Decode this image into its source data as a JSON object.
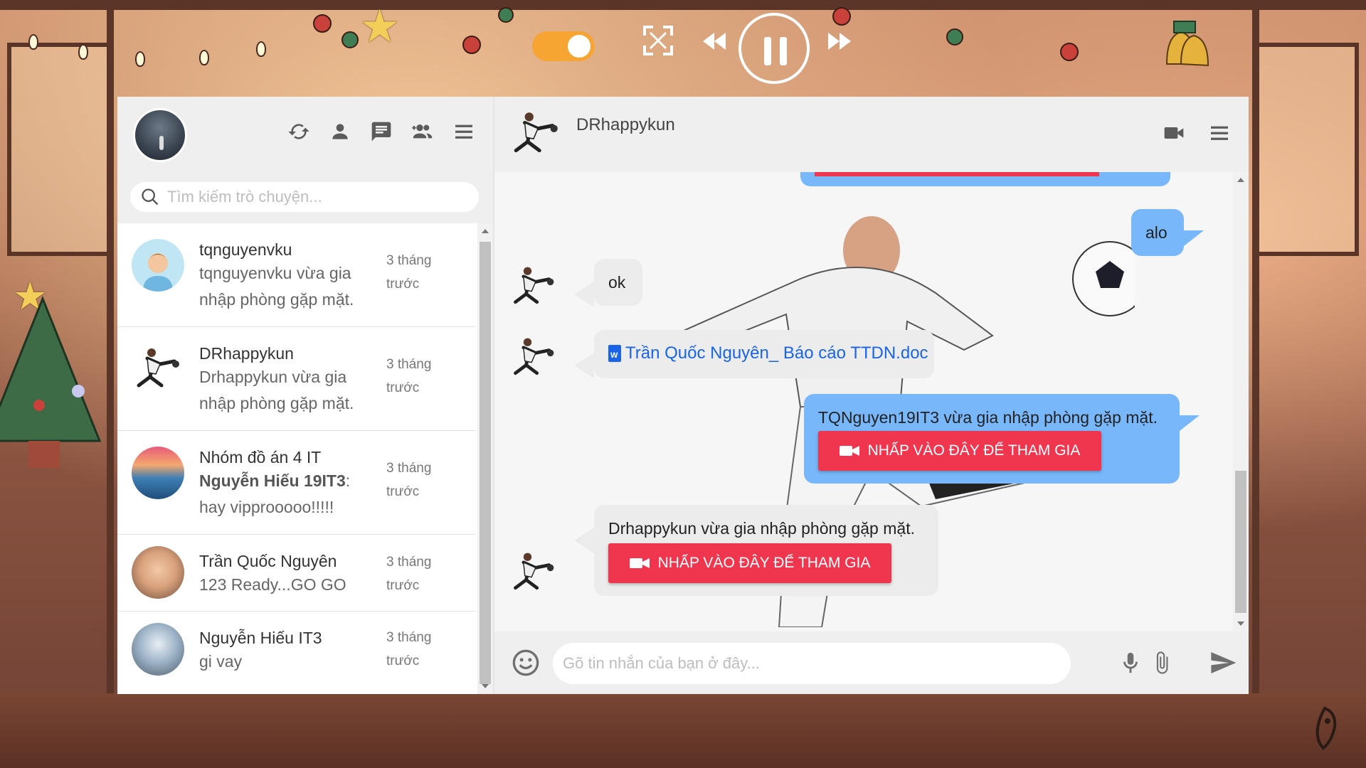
{
  "player": {
    "toggle_on": true,
    "icons": [
      "toggle-switch",
      "fullscreen-icon",
      "rewind-icon",
      "pause-icon",
      "fast-forward-icon"
    ]
  },
  "sidebar": {
    "search": {
      "placeholder": "Tìm kiếm trò chuyện..."
    },
    "icons": [
      "refresh-icon",
      "person-icon",
      "chat-icon",
      "group-add-icon",
      "menu-icon"
    ],
    "conversations": [
      {
        "name": "tqnguyenvku",
        "preview": "tqnguyenvku vừa gia nhập phòng gặp mặt.",
        "time": "3 tháng trước"
      },
      {
        "name": "DRhappykun",
        "preview": "Drhappykun vừa gia nhập phòng gặp mặt.",
        "time": "3 tháng trước"
      },
      {
        "name": "Nhóm đồ án 4 IT",
        "sender": "Nguyễn Hiếu 19IT3",
        "preview": ": hay vipprooooo!!!!!",
        "time": "3 tháng trước"
      },
      {
        "name": "Trần Quốc Nguyên",
        "preview": "123 Ready...GO GO",
        "time": "3 tháng trước"
      },
      {
        "name": "Nguyễn Hiếu IT3",
        "preview": "gi vay",
        "time": "3 tháng trước"
      }
    ]
  },
  "chat": {
    "title": "DRhappykun",
    "icons": [
      "video-call-icon",
      "menu-icon"
    ],
    "messages": {
      "m1": "alo",
      "m2": "ok",
      "m3": "Trần Quốc Nguyên_ Báo cáo TTDN.doc",
      "m4": "TQNguyen19IT3 vừa gia nhập phòng gặp mặt.",
      "m4_button": "NHẤP VÀO ĐÂY ĐỂ THAM GIA",
      "m5": "Drhappykun vừa gia nhập phòng gặp mặt.",
      "m5_button": "NHẤP VÀO ĐÂY ĐỂ THAM GIA"
    },
    "input": {
      "placeholder": "Gõ tin nhắn của bạn ở đây...",
      "value": ""
    }
  },
  "colors": {
    "outgoing_bubble": "#78b7fa",
    "incoming_bubble": "#ececec",
    "join_button": "#f0364f",
    "file_link": "#1a64e8",
    "toggle": "#f7a532"
  }
}
